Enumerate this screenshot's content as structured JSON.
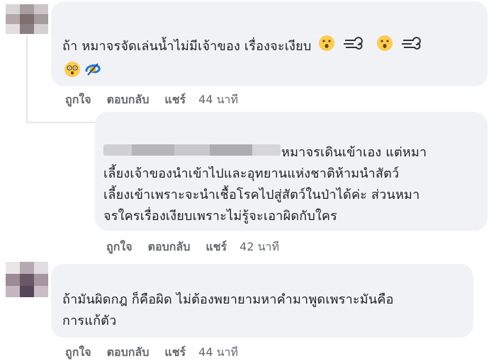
{
  "comments": [
    {
      "author": "",
      "lines": [
        "ถ้า หมาจรจัดเล่นน้ำไม่มีเจ้าของ เรื่องจะเงียบ"
      ],
      "emoji": [
        "hushed-face",
        "dashing-away",
        "hushed-face",
        "dashing-away",
        "dizzy-face",
        "dizzy-symbol"
      ],
      "actions": {
        "like": "ถูกใจ",
        "reply": "ตอบกลับ",
        "share": "แชร์",
        "time": "44 นาที"
      }
    },
    {
      "author": "",
      "lines": [
        "หมาจรเดินเข้าเอง แต่หมา",
        "เลี้ยงเจ้าของนำเข้าไปและอุทยานแห่งชาติห้ามนำสัตว์",
        "เลี้ยงเข้าเพราะจะนำเชื้อโรคไปสู่สัตว์ในป่าได้ค่ะ ส่วนหมา",
        "จรใครเรื่องเงียบเพราะไม่รู้จะเอาผิดกับใคร"
      ],
      "actions": {
        "like": "ถูกใจ",
        "reply": "ตอบกลับ",
        "share": "แชร์",
        "time": "42 นาที"
      }
    },
    {
      "author": "",
      "lines": [
        "ถ้ามันผิดกฎ ก็คือผิด ไม่ต้องพยายามหาคำมาพูดเพราะมันคือ",
        "การแก้ตัว"
      ],
      "actions": {
        "like": "ถูกใจ",
        "reply": "ตอบกลับ",
        "share": "แชร์",
        "time": "44 นาที"
      }
    }
  ],
  "colors": {
    "bubble": "#f0f2f5",
    "action_text": "#65676b",
    "thread_line": "#e4e6eb",
    "emoji_yellow": "#ffcc4d"
  }
}
